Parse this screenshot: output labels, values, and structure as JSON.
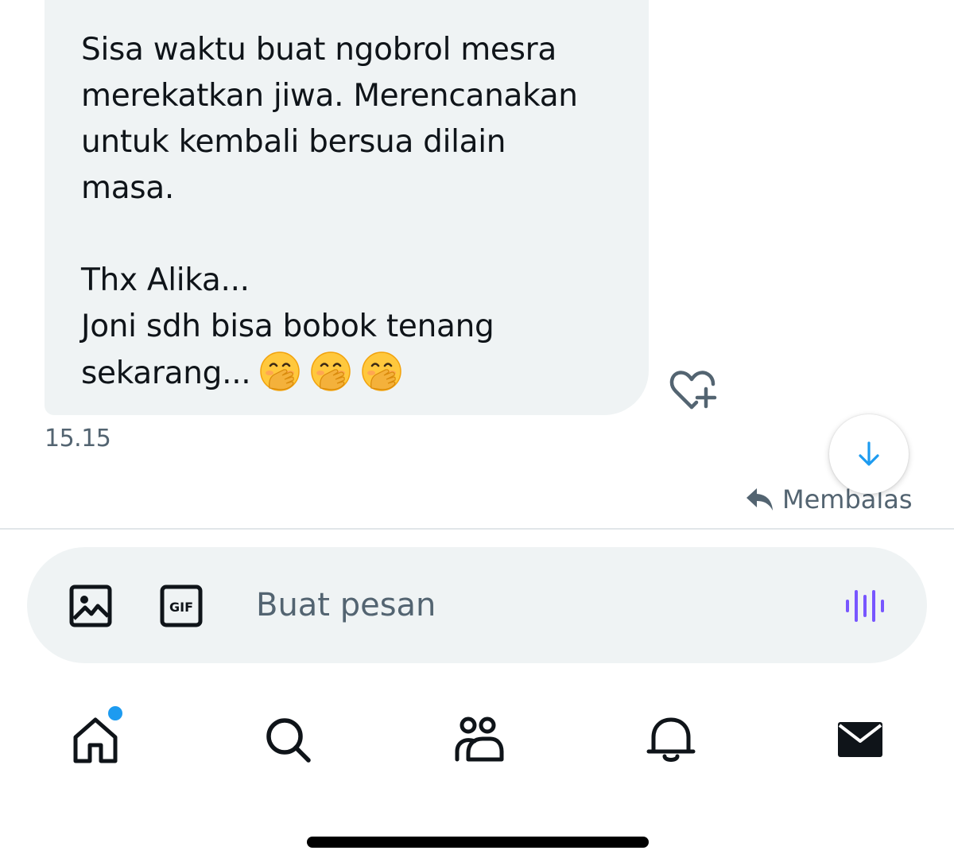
{
  "message": {
    "lines": [
      "Sisa waktu buat ngobrol mesra",
      "merekatkan jiwa. Merencanakan",
      "untuk kembali bersua dilain",
      "masa.",
      "",
      "Thx Alika...",
      "Joni sdh bisa bobok tenang"
    ],
    "last_line": "sekarang...",
    "emoji_count": 3,
    "emoji_name": "face-with-hand-over-mouth-emoji",
    "timestamp": "15.15"
  },
  "reply_label": "Membalas",
  "composer": {
    "placeholder": "Buat pesan",
    "value": "",
    "gif_label": "GIF"
  },
  "nav": {
    "items": [
      "home-icon",
      "search-icon",
      "communities-icon",
      "notifications-icon",
      "messages-icon"
    ],
    "home_has_badge": true
  },
  "colors": {
    "bubble_bg": "#eff3f4",
    "secondary_text": "#536471",
    "accent_blue": "#1d9bf0",
    "voice_purple": "#7856ff"
  }
}
